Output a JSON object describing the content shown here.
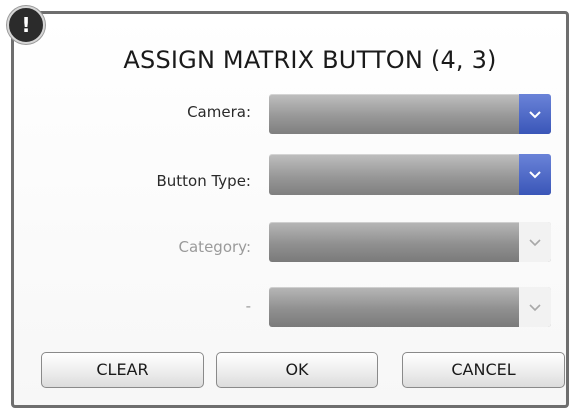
{
  "dialog": {
    "alert_glyph": "!",
    "title": "ASSIGN MATRIX BUTTON (4, 3)"
  },
  "fields": [
    {
      "label": "Camera:",
      "value": "",
      "enabled": true,
      "icon": "chevron-down-icon"
    },
    {
      "label": "Button Type:",
      "value": "",
      "enabled": true,
      "icon": "chevron-down-icon"
    },
    {
      "label": "Category:",
      "value": "",
      "enabled": false,
      "icon": "chevron-down-icon"
    },
    {
      "label": "-",
      "value": "",
      "enabled": false,
      "icon": "chevron-down-icon"
    }
  ],
  "buttons": {
    "clear": "CLEAR",
    "ok": "OK",
    "cancel": "CANCEL"
  },
  "colors": {
    "dropdown_active_accent": "#3a56b8",
    "dropdown_body": "#989898",
    "disabled_label": "#9a9a9a"
  }
}
